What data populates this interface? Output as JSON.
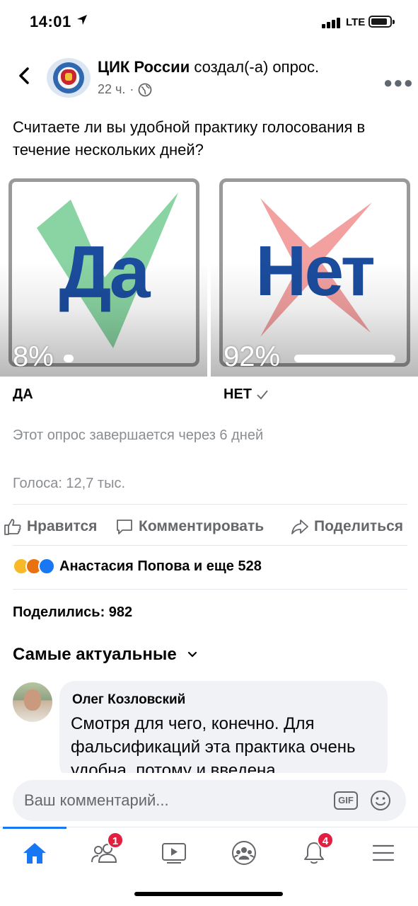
{
  "status_bar": {
    "time": "14:01",
    "network": "LTE"
  },
  "post": {
    "author": "ЦИК России",
    "action": "создал(-а) опрос.",
    "time": "22 ч.",
    "question": "Считаете ли вы удобной практику голосования в течение нескольких дней?"
  },
  "poll": {
    "options": [
      {
        "image_text": "Да",
        "percent_label": "8%",
        "percent": 8,
        "label": "ДА",
        "selected": false
      },
      {
        "image_text": "Нет",
        "percent_label": "92%",
        "percent": 92,
        "label": "НЕТ",
        "selected": true
      }
    ],
    "ends": "Этот опрос завершается через 6 дней",
    "votes": "Голоса: 12,7 тыс."
  },
  "actions": {
    "like": "Нравится",
    "comment": "Комментировать",
    "share": "Поделиться"
  },
  "reactions": {
    "icons": [
      "haha",
      "angry",
      "like"
    ],
    "text": "Анастасия Попова и еще 528"
  },
  "shares": "Поделились: 982",
  "comments_sort": "Самые актуальные",
  "comment": {
    "author": "Олег Козловский",
    "text": "Смотря для чего, конечно. Для фальсификаций эта практика очень удобна, потому и введена"
  },
  "composer": {
    "placeholder": "Ваш комментарий...",
    "gif": "GIF"
  },
  "tabbar": {
    "tabs": [
      "home",
      "friends",
      "watch",
      "groups",
      "notifications",
      "menu"
    ],
    "active": "home",
    "friends_badge": "1",
    "notifications_badge": "4"
  },
  "colors": {
    "accent": "#1877f2",
    "poll_text": "#1b4c9d",
    "check_green": "#7ccf98",
    "cross_red": "#f08f8f",
    "badge": "#e41e3f"
  }
}
